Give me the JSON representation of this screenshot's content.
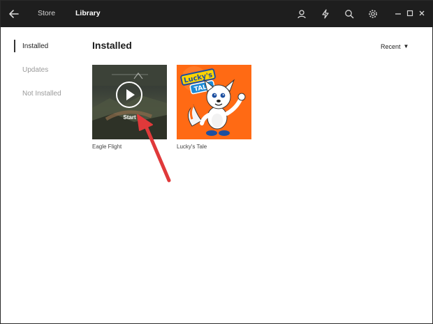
{
  "titlebar": {
    "nav": {
      "store": "Store",
      "library": "Library"
    },
    "icons": [
      "back-arrow-icon",
      "user-icon",
      "lightning-icon",
      "search-icon",
      "gear-icon",
      "minimize-icon",
      "maximize-icon",
      "close-icon"
    ]
  },
  "sidebar": {
    "items": [
      {
        "label": "Installed",
        "selected": true
      },
      {
        "label": "Updates",
        "selected": false
      },
      {
        "label": "Not Installed",
        "selected": false
      }
    ]
  },
  "main": {
    "title": "Installed",
    "sort": {
      "label": "Recent"
    },
    "games": [
      {
        "title": "Eagle Flight",
        "hover_action": "Start"
      },
      {
        "title": "Lucky's Tale"
      }
    ]
  },
  "colors": {
    "titlebar": "#1e1e1e",
    "accent_arrow": "#e0393a",
    "lucky_bg": "#ff6a14"
  }
}
